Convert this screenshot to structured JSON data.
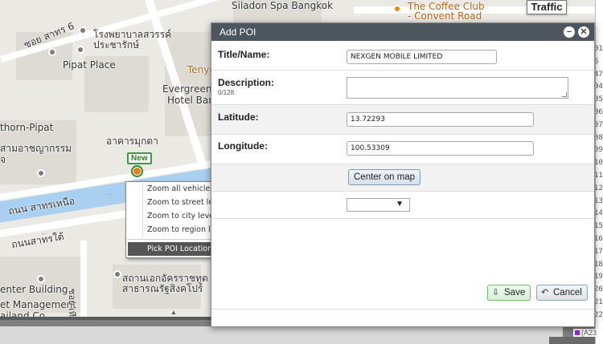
{
  "map": {
    "labels": {
      "siladon": "Siladon Spa Bangkok",
      "coffee1": "The Coffee Club",
      "coffee2": "- Convent Road",
      "soi6": "ซอย สาทร 6",
      "hosp1": "โรงพยาบาลสวรรค์",
      "hosp2": "ประชารักษ์",
      "pipat_place": "Pipat Place",
      "tenyo": "Tenyu",
      "evergreen1": "Evergreen L",
      "evergreen2": "Hotel Ban",
      "thorn": "thorn-Pipat",
      "school1": "สามอาชญากรรม",
      "school2": "จ",
      "bldg": "อาคารมุกดา",
      "road_n": "ถนน สาทรเหนือ",
      "road_s": "ถนนสาทรใต้",
      "center_bldg": "enter Building",
      "mgmt": "et Management",
      "thailand": "ailand Co.",
      "embassy1": "สถานเอกอัครราชทูต",
      "embassy2": "สาธารณรัฐสิงคโปร์",
      "soi_side": "ซอย เทียน"
    },
    "marker_label": "New",
    "traffic_button": "Traffic"
  },
  "context_menu": {
    "items": [
      "Zoom all vehicles",
      "Zoom to street level",
      "Zoom to city level",
      "Zoom to region level"
    ],
    "highlighted": "Pick POI Location"
  },
  "dialog": {
    "title": "Add POI",
    "fields": {
      "title_label": "Title/Name:",
      "title_value": "NEXGEN MOBILE LIMITED",
      "desc_label": "Description:",
      "desc_counter": "0/128",
      "desc_value": "",
      "lat_label": "Latitude:",
      "lat_value": "13.72293",
      "lng_label": "Longitude:",
      "lng_value": "100.53309"
    },
    "center_button": "Center on map",
    "select_value": "",
    "save_button": "Save",
    "cancel_button": "Cancel"
  },
  "right_strip": {
    "numbers": [
      "01",
      "5",
      "47",
      "04",
      "05",
      "06",
      "07",
      "08",
      "09",
      "10",
      "11",
      "12",
      "13",
      "14",
      "15",
      "16",
      "17",
      "18",
      "19",
      "20",
      "21",
      "22"
    ]
  },
  "status_tag": "(A23"
}
